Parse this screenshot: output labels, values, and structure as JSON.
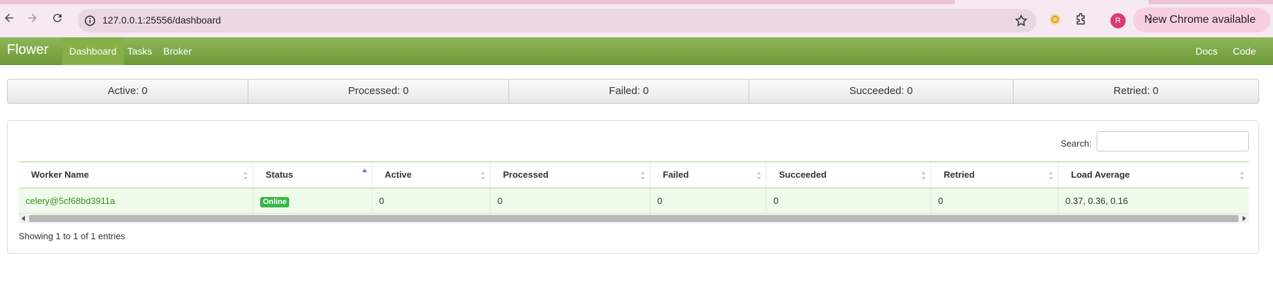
{
  "browser": {
    "url": "127.0.0.1:25556/dashboard",
    "profile_initial": "R",
    "update_label": "New Chrome available",
    "update_menu_glyph": "⋮",
    "icons": [
      "back-icon",
      "forward-icon",
      "reload-icon",
      "site-info-icon",
      "bookmark-star-icon",
      "extension-icon",
      "puzzle-icon",
      "profile-icon",
      "more-icon"
    ]
  },
  "navbar": {
    "brand": "Flower",
    "items": [
      "Dashboard",
      "Tasks",
      "Broker"
    ],
    "active": "Dashboard",
    "right_items": [
      "Docs",
      "Code"
    ],
    "colors": {
      "bar": "#7ba544",
      "active": "#86b047"
    }
  },
  "summary": {
    "active": "Active: 0",
    "processed": "Processed: 0",
    "failed": "Failed: 0",
    "succeeded": "Succeeded: 0",
    "retried": "Retried: 0"
  },
  "workers": {
    "search_label": "Search:",
    "search_value": "",
    "columns": [
      "Worker Name",
      "Status",
      "Active",
      "Processed",
      "Failed",
      "Succeeded",
      "Retried",
      "Load Average"
    ],
    "sorted_column": "Status",
    "rows": [
      {
        "name": "celery@5cf68bd3911a",
        "status": "Online",
        "active": "0",
        "processed": "0",
        "failed": "0",
        "succeeded": "0",
        "retried": "0",
        "load": "0.37, 0.36, 0.16"
      }
    ],
    "info": "Showing 1 to 1 of 1 entries",
    "status_color": "#39b54a"
  }
}
